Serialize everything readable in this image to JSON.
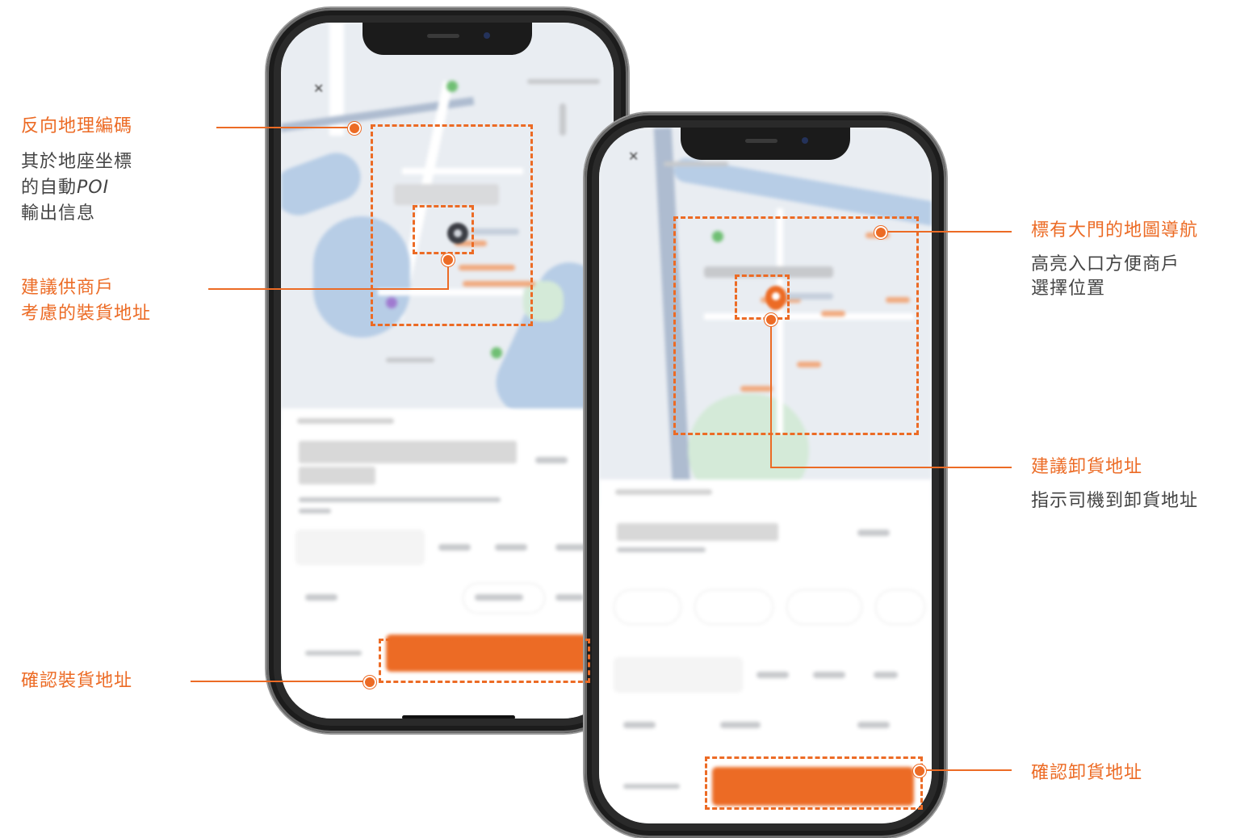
{
  "annotations": {
    "reverse_geocoding": {
      "title": "反向地理編碼",
      "desc_line1": "其於地座坐標",
      "desc_line2_prefix": "的自動",
      "desc_line2_italic": "POI",
      "desc_line3": "輸出信息"
    },
    "suggested_pickup": {
      "title_line1": "建議供商戶",
      "title_line2": "考慮的裝貨地址"
    },
    "confirm_pickup": {
      "title": "確認裝貨地址"
    },
    "gate_navigation": {
      "title": "標有大門的地圖導航",
      "desc_line1": "高亮入口方便商戶",
      "desc_line2": "選擇位置"
    },
    "suggested_dropoff": {
      "title": "建議卸貨地址",
      "desc": "指示司機到卸貨地址"
    },
    "confirm_dropoff": {
      "title": "確認卸貨地址"
    }
  },
  "colors": {
    "accent": "#ec6b25",
    "text": "#444444",
    "phone_frame": "#2a2a2a"
  },
  "icons": {
    "close": "close-icon",
    "pin_pickup": "map-pin-icon",
    "pin_dropoff": "map-pin-icon"
  }
}
